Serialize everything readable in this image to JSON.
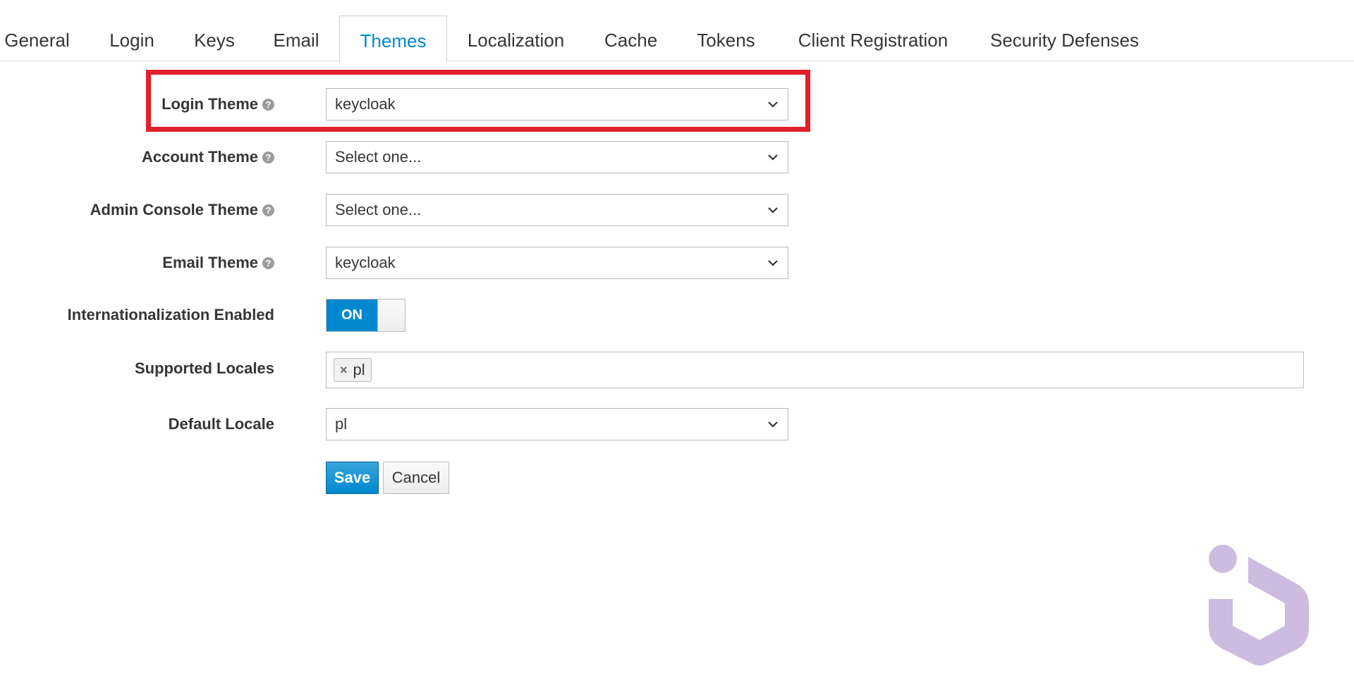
{
  "tabs": [
    {
      "label": "General"
    },
    {
      "label": "Login"
    },
    {
      "label": "Keys"
    },
    {
      "label": "Email"
    },
    {
      "label": "Themes",
      "active": true
    },
    {
      "label": "Localization"
    },
    {
      "label": "Cache"
    },
    {
      "label": "Tokens"
    },
    {
      "label": "Client Registration"
    },
    {
      "label": "Security Defenses"
    }
  ],
  "form": {
    "login_theme": {
      "label": "Login Theme",
      "value": "keycloak"
    },
    "account_theme": {
      "label": "Account Theme",
      "value": "Select one..."
    },
    "admin_console_theme": {
      "label": "Admin Console Theme",
      "value": "Select one..."
    },
    "email_theme": {
      "label": "Email Theme",
      "value": "keycloak"
    },
    "internationalization": {
      "label": "Internationalization Enabled",
      "state": "ON"
    },
    "supported_locales": {
      "label": "Supported Locales",
      "chips": [
        "pl"
      ]
    },
    "default_locale": {
      "label": "Default Locale",
      "value": "pl"
    }
  },
  "buttons": {
    "save": "Save",
    "cancel": "Cancel"
  },
  "colors": {
    "accent": "#0088ce",
    "highlight": "#e2202b",
    "logo": "#cdbbe0"
  },
  "icons": {
    "help": "question-circle-icon",
    "select": "chevron-down-icon",
    "remove": "times-icon"
  }
}
